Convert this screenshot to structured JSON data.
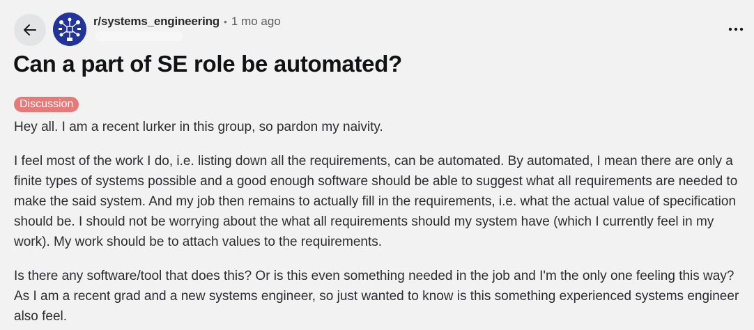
{
  "header": {
    "subreddit": "r/systems_engineering",
    "separator": "•",
    "time": "1 mo ago"
  },
  "post": {
    "title": "Can a part of SE role be automated?",
    "flair": "Discussion",
    "paragraphs": [
      "Hey all. I am a recent lurker in this group, so pardon my naivity.",
      "I feel most of the work I do, i.e. listing down all the requirements, can be automated. By automated, I mean there are only a finite types of systems possible and a good enough software should be able to suggest what all requirements are needed to make the said system. And my job then remains to actually fill in the requirements, i.e. what the actual value of specification should be. I should not be worrying about the what all requirements should my system have (which I currently feel in my work). My work should be to attach values to the requirements.",
      "Is there any software/tool that does this? Or is this even something needed in the job and I'm the only one feeling this way? As I am a recent grad and a new systems engineer, so just wanted to know is this something experienced systems engineer also feel."
    ]
  },
  "icons": {
    "back": "arrow-left-icon",
    "more": "more-horizontal-icon",
    "avatar": "subreddit-avatar"
  },
  "colors": {
    "background": "#f2f2f3",
    "flair_bg": "#e67a78",
    "avatar_bg": "#22349a"
  }
}
